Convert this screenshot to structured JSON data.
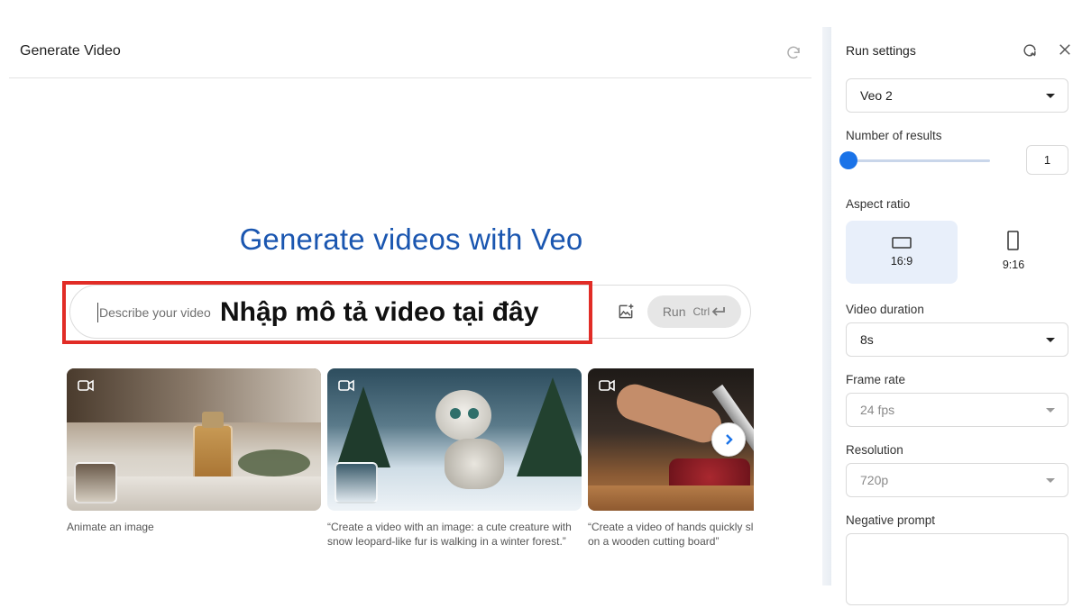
{
  "header": {
    "title": "Generate Video"
  },
  "hero": {
    "prefix": "Generate videos",
    "suffix": " with Veo"
  },
  "prompt": {
    "placeholder": "Describe your video",
    "value": ""
  },
  "run": {
    "label": "Run",
    "shortcut": "Ctrl"
  },
  "callout": {
    "text": "Nhập mô tả video tại đây"
  },
  "gallery": {
    "cards": [
      {
        "caption_line1": "Animate an image",
        "caption_line2": ""
      },
      {
        "caption_line1": "“Create a video with an image: a cute creature with",
        "caption_line2": "snow leopard-like fur is walking in a winter forest.”"
      },
      {
        "caption_line1": "“Create a video of hands quickly sl",
        "caption_line2": "on a wooden cutting board”"
      }
    ]
  },
  "settings": {
    "title": "Run settings",
    "model": {
      "value": "Veo 2"
    },
    "number_of_results": {
      "label": "Number of results",
      "value": "1"
    },
    "aspect_ratio": {
      "label": "Aspect ratio",
      "options": [
        "16:9",
        "9:16"
      ],
      "selected": "16:9"
    },
    "video_duration": {
      "label": "Video duration",
      "value": "8s"
    },
    "frame_rate": {
      "label": "Frame rate",
      "value": "24 fps"
    },
    "resolution": {
      "label": "Resolution",
      "value": "720p"
    },
    "negative_prompt": {
      "label": "Negative prompt",
      "value": ""
    }
  },
  "colors": {
    "accent": "#1a73e8",
    "hero_blue": "#1a56b0",
    "callout_red": "#e12c26",
    "selected_bg": "#e8effa"
  },
  "icons": [
    "refresh-icon",
    "add-image-icon",
    "enter-key-icon",
    "video-camera-icon",
    "chevron-right-icon",
    "reset-settings-icon",
    "close-icon",
    "landscape-ratio-icon",
    "portrait-ratio-icon",
    "dropdown-caret-icon"
  ]
}
